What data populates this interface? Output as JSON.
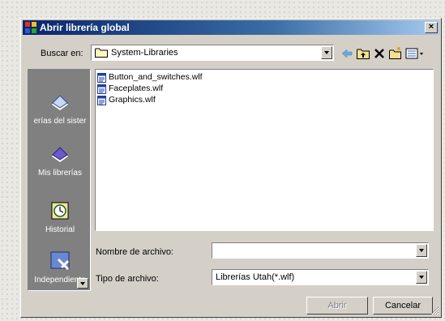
{
  "dialog": {
    "title": "Abrir librería global",
    "close_glyph": "×",
    "app_icon": "app-icon"
  },
  "look_in": {
    "label": "Buscar en:",
    "value": "System-Libraries",
    "folder_icon": "folder-icon"
  },
  "toolbar": {
    "icons": [
      "back-arrow-icon",
      "up-folder-icon",
      "delete-icon",
      "new-folder-icon",
      "view-menu-icon"
    ]
  },
  "places": [
    {
      "label": "erías del sister",
      "icon": "book-icon"
    },
    {
      "label": "Mis librerías",
      "icon": "book-icon"
    },
    {
      "label": "Historial",
      "icon": "history-icon"
    },
    {
      "label": "Independiente",
      "icon": "network-icon"
    }
  ],
  "files": [
    {
      "name": "Button_and_switches.wlf",
      "icon": "wlf-file-icon"
    },
    {
      "name": "Faceplates.wlf",
      "icon": "wlf-file-icon"
    },
    {
      "name": "Graphics.wlf",
      "icon": "wlf-file-icon"
    }
  ],
  "filename": {
    "label": "Nombre de archivo:",
    "value": ""
  },
  "filetype": {
    "label": "Tipo de archivo:",
    "value": "Librerías Utah(*.wlf)"
  },
  "buttons": {
    "open": "Abrir",
    "cancel": "Cancelar"
  },
  "colors": {
    "title_start": "#0a246a",
    "title_end": "#a6caf0",
    "face": "#d4d0c8",
    "places_bg": "#808080"
  }
}
